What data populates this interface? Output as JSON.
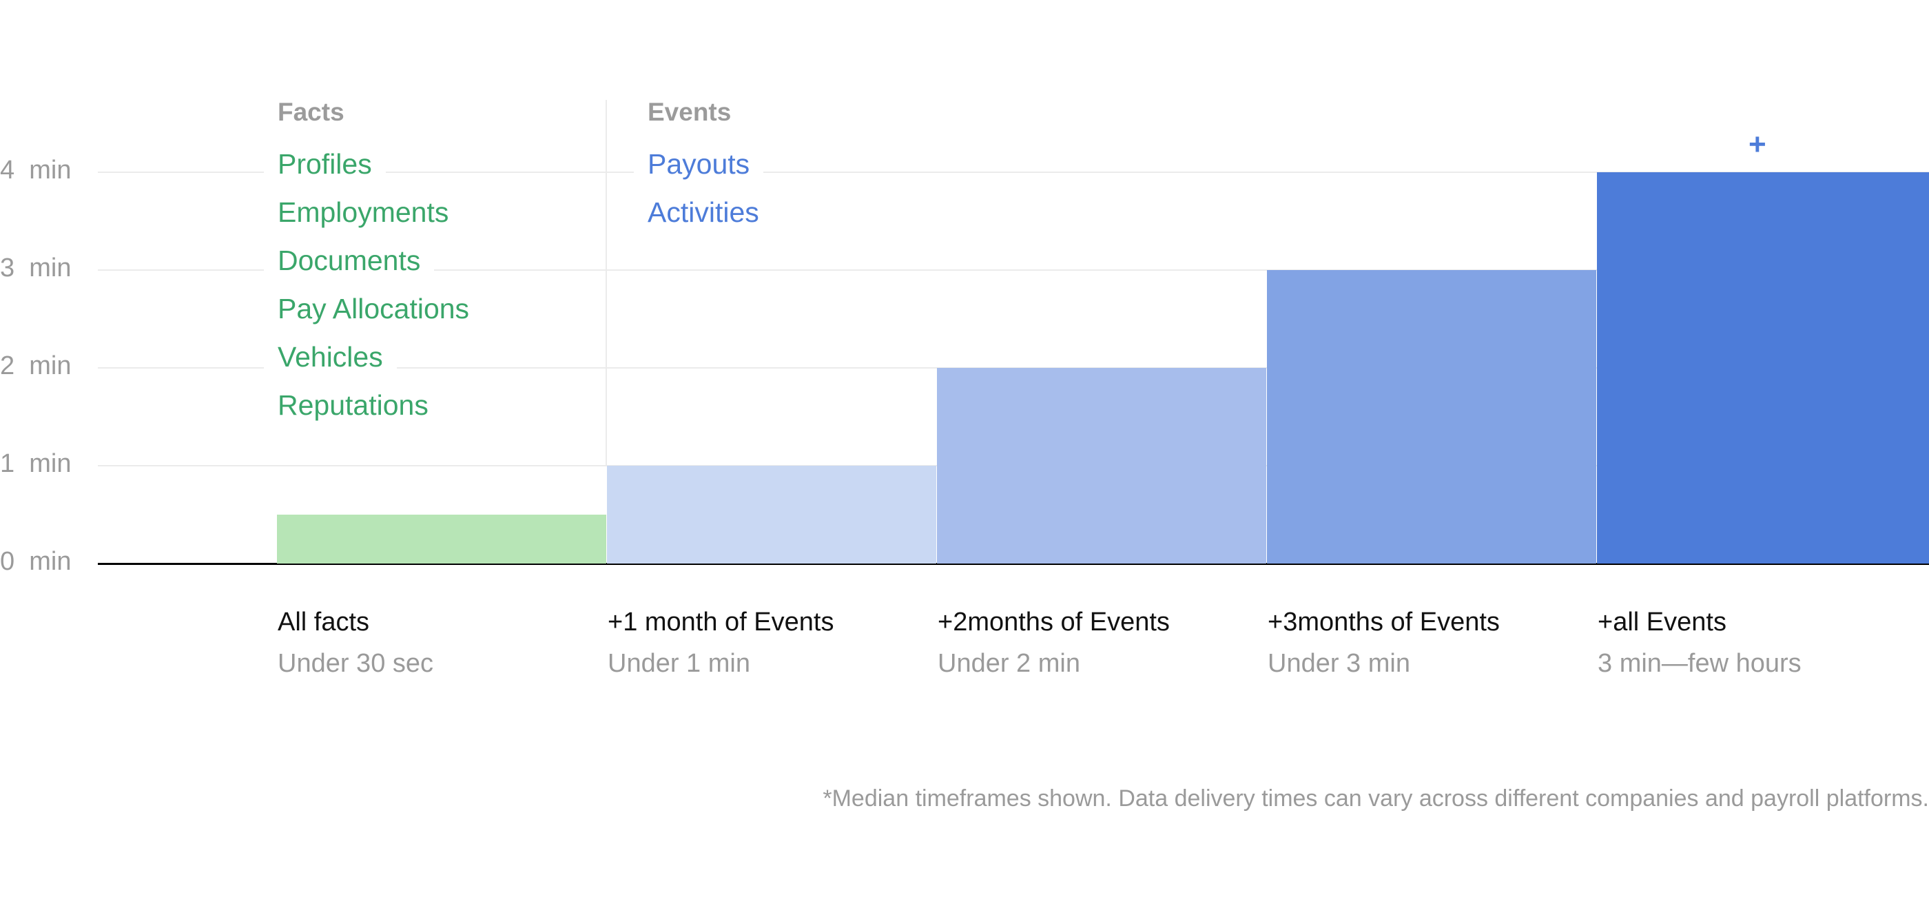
{
  "chart_data": {
    "type": "bar",
    "title": "",
    "xlabel": "",
    "ylabel": "",
    "ylim": [
      0,
      4
    ],
    "y_unit": "min",
    "grid": true,
    "y_ticks": [
      {
        "value": 0,
        "label": "0  min"
      },
      {
        "value": 1,
        "label": "1  min"
      },
      {
        "value": 2,
        "label": "2  min"
      },
      {
        "value": 3,
        "label": "3  min"
      },
      {
        "value": 4,
        "label": "4  min"
      }
    ],
    "categories": [
      "All facts",
      "+1 month of Events",
      "+2months of Events",
      "+3months of Events",
      "+all Events"
    ],
    "subtitles": [
      "Under 30 sec",
      "Under 1 min",
      "Under 2 min",
      "Under 3 min",
      "3 min—few hours"
    ],
    "values": [
      0.5,
      1,
      2,
      3,
      4
    ],
    "bar_colors": [
      "#b7e5b6",
      "#c9d8f3",
      "#a7bdec",
      "#82a3e4",
      "#4d7cd9"
    ],
    "overflow_marker": {
      "category": "+all Events",
      "symbol": "+",
      "color": "#4d7cd9"
    },
    "groups": [
      {
        "heading": "Facts",
        "color": "#3aa66a",
        "items": [
          "Profiles",
          "Employments",
          "Documents",
          "Pay Allocations",
          "Vehicles",
          "Reputations"
        ]
      },
      {
        "heading": "Events",
        "color": "#4d7cd9",
        "items": [
          "Payouts",
          "Activities"
        ]
      }
    ],
    "footnote": "*Median timeframes shown. Data delivery times can vary across different companies and payroll platforms."
  }
}
